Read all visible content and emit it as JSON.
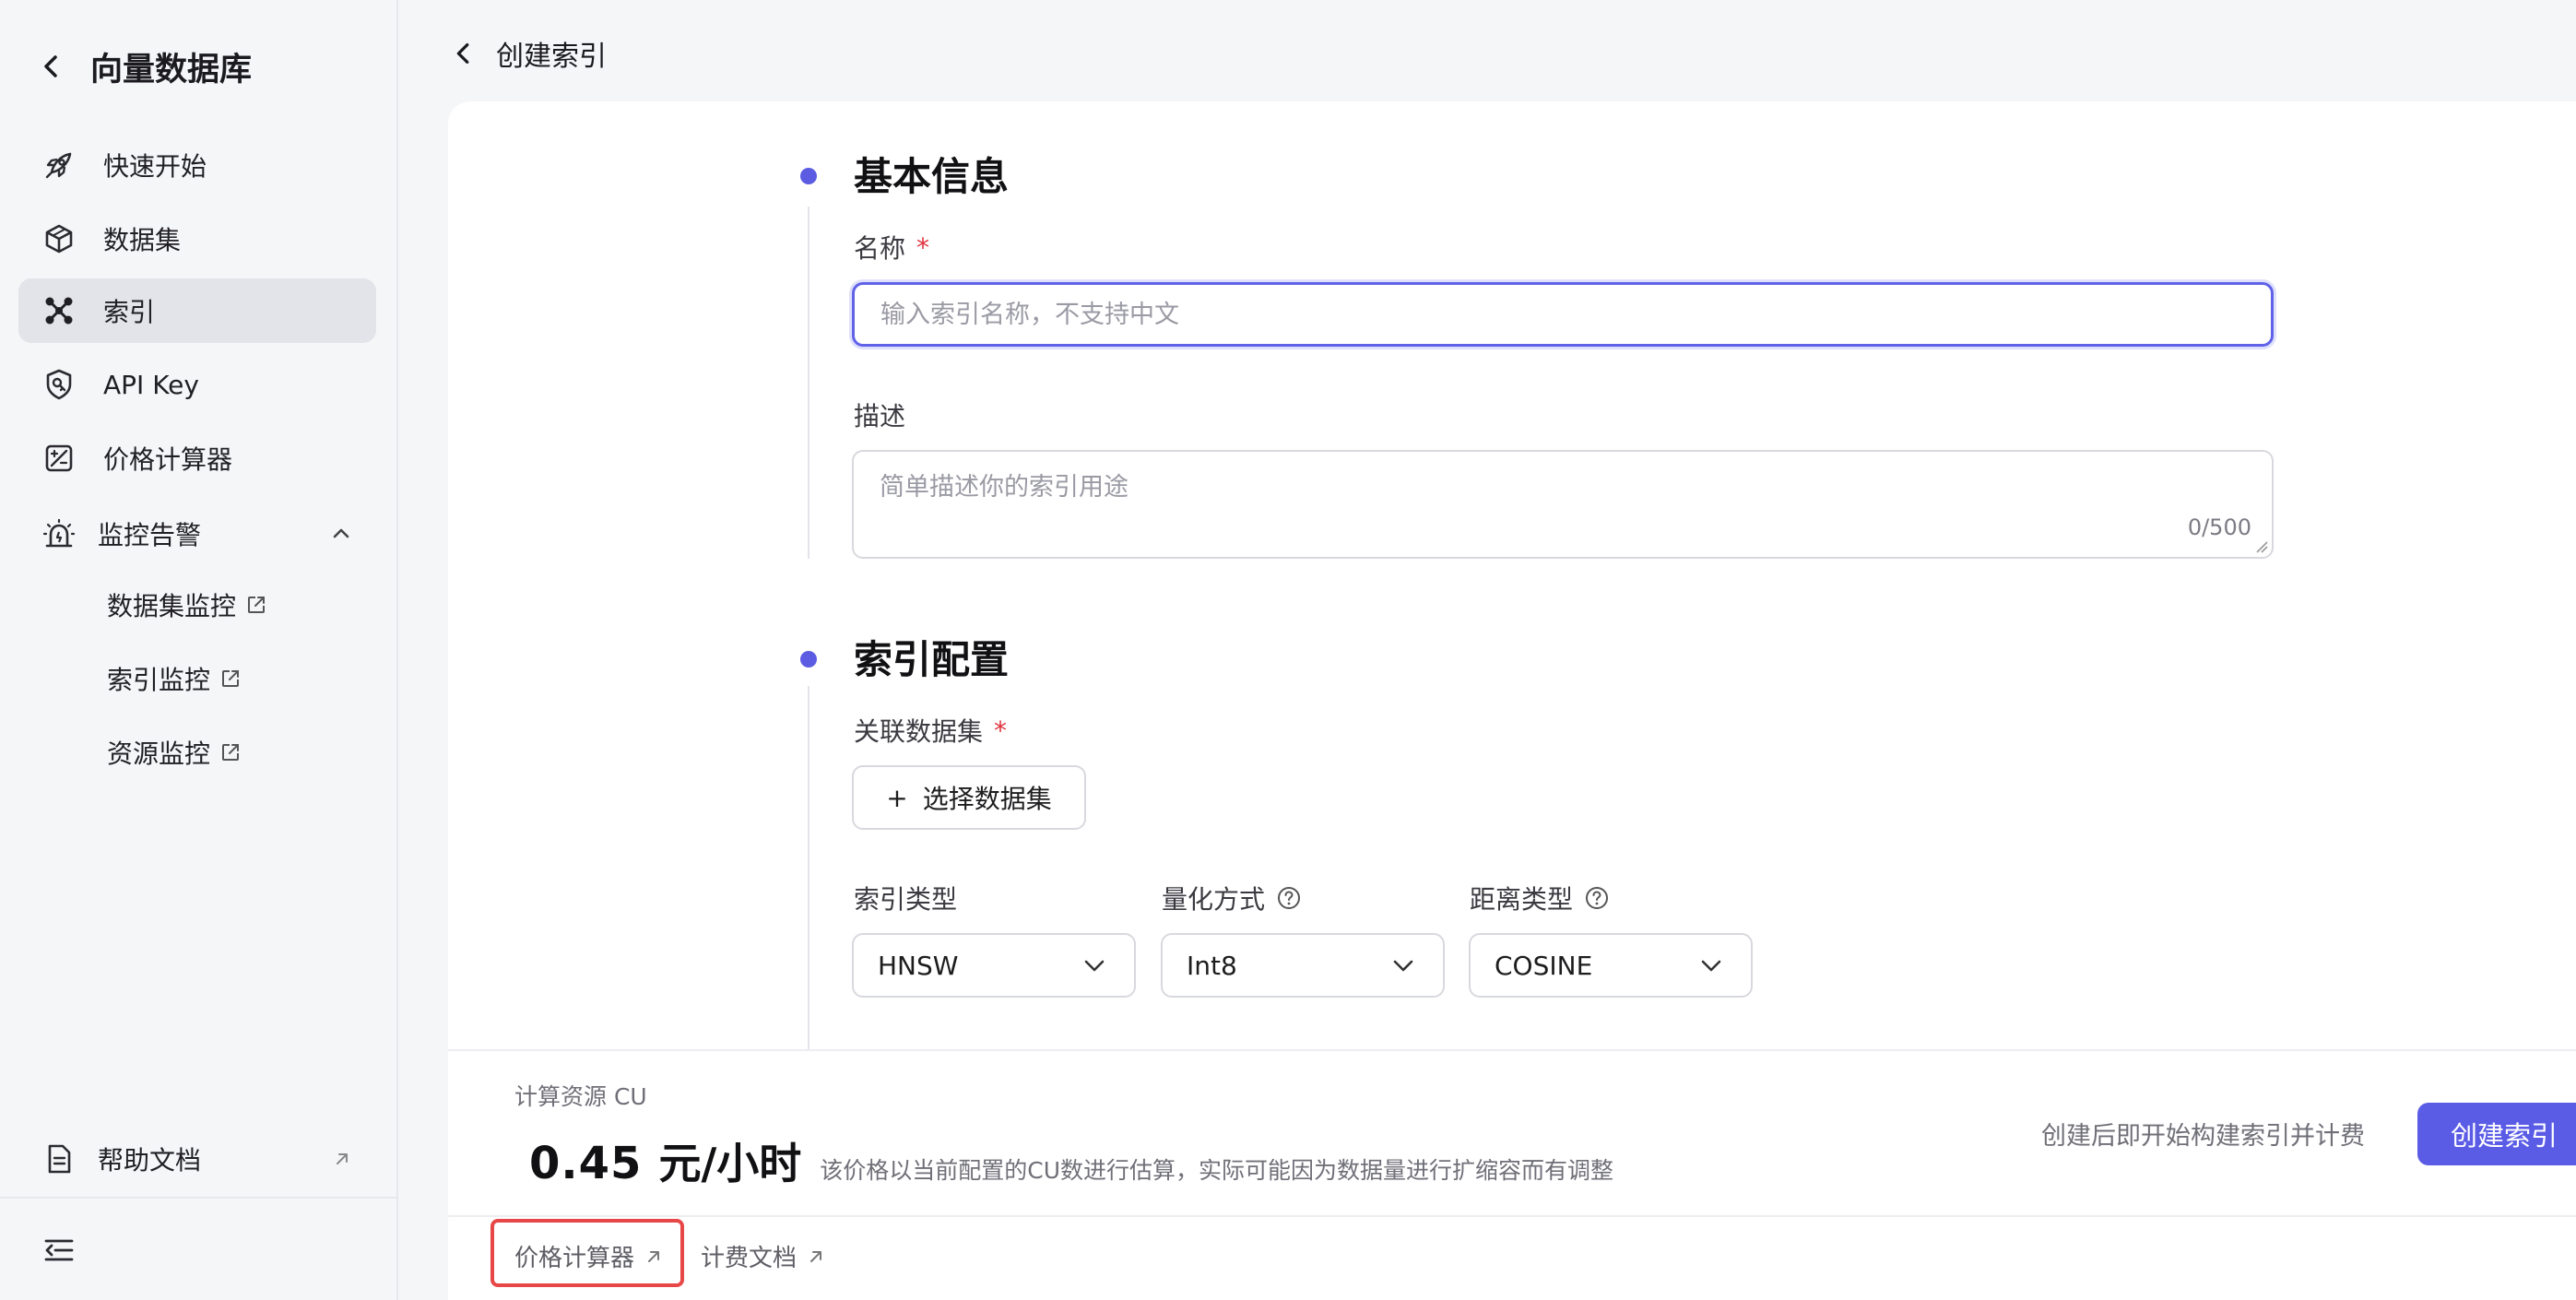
{
  "sidebar": {
    "title": "向量数据库",
    "items": [
      {
        "label": "快速开始",
        "icon": "rocket-icon"
      },
      {
        "label": "数据集",
        "icon": "cube-icon"
      },
      {
        "label": "索引",
        "icon": "nodes-icon",
        "active": true
      },
      {
        "label": "API Key",
        "icon": "shield-key-icon"
      },
      {
        "label": "价格计算器",
        "icon": "calculator-icon"
      },
      {
        "label": "监控告警",
        "icon": "alarm-icon",
        "expanded": true
      }
    ],
    "monitor_children": [
      {
        "label": "数据集监控",
        "icon": "external-link-icon"
      },
      {
        "label": "索引监控",
        "icon": "external-link-icon"
      },
      {
        "label": "资源监控",
        "icon": "external-link-icon"
      }
    ],
    "help": {
      "label": "帮助文档",
      "icon": "document-icon"
    }
  },
  "header": {
    "title": "创建索引"
  },
  "basic_info": {
    "title": "基本信息",
    "name_label": "名称",
    "name_required_mark": "*",
    "name_value": "",
    "name_placeholder": "输入索引名称，不支持中文",
    "desc_label": "描述",
    "desc_value": "",
    "desc_placeholder": "简单描述你的索引用途",
    "desc_count": "0/500"
  },
  "index_config": {
    "title": "索引配置",
    "dataset_label": "关联数据集",
    "dataset_required_mark": "*",
    "dataset_button_icon": "+",
    "dataset_button": "选择数据集",
    "index_type_label": "索引类型",
    "index_type_value": "HNSW",
    "quant_label": "量化方式",
    "quant_value": "Int8",
    "distance_label": "距离类型",
    "distance_value": "COSINE"
  },
  "footer": {
    "cu_label": "计算资源 CU",
    "price_value": "0.45",
    "price_unit": "元/小时",
    "price_note": "该价格以当前配置的CU数进行估算，实际可能因为数据量进行扩缩容而有调整",
    "billing_note": "创建后即开始构建索引并计费",
    "create_button": "创建索引",
    "links": [
      {
        "label": "价格计算器",
        "highlighted": true
      },
      {
        "label": "计费文档"
      }
    ]
  },
  "colors": {
    "accent": "#5b5ce6",
    "required": "#e0343f",
    "highlight": "#e84747",
    "active_nav_bg": "#e3e4ea"
  }
}
